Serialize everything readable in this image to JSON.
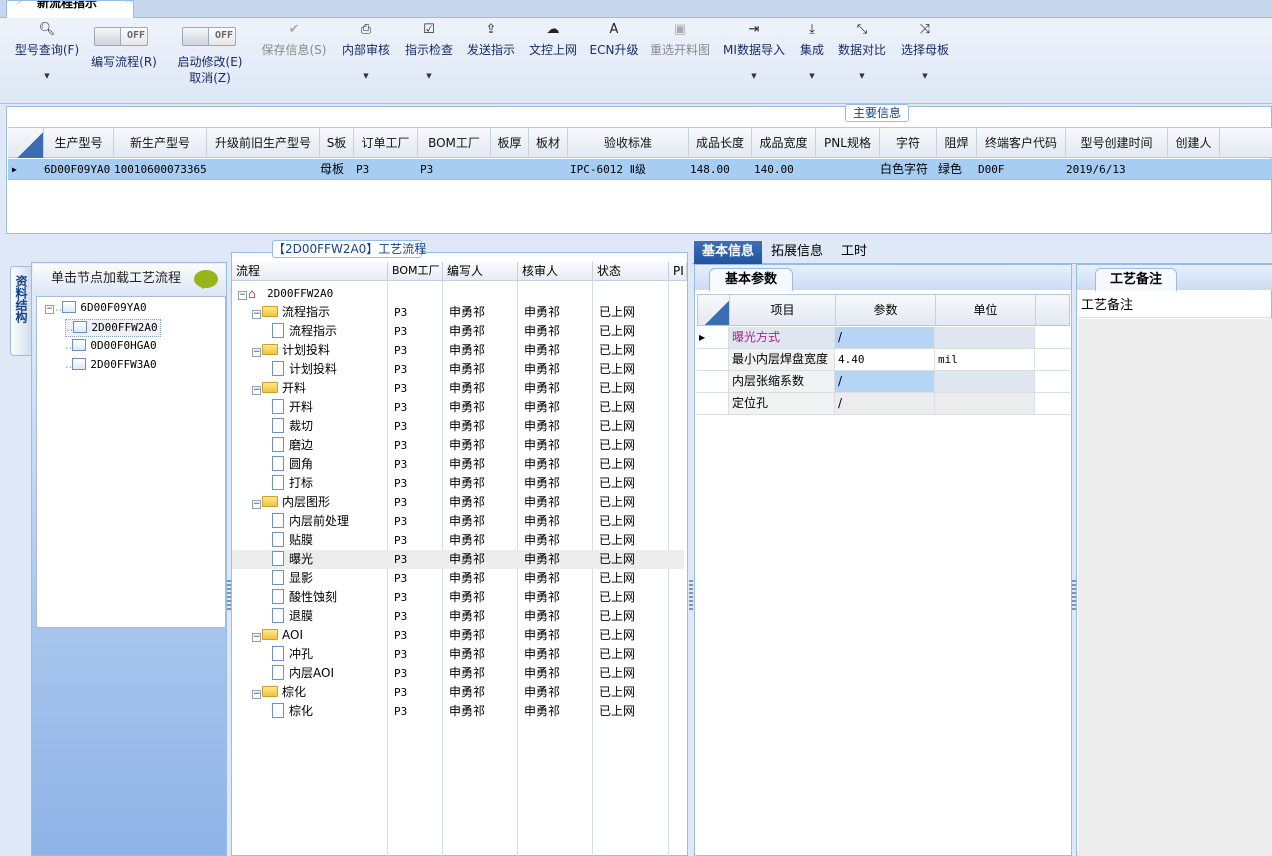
{
  "document_tab": {
    "title": "新流程指示",
    "close": "×"
  },
  "toolbar": {
    "model_query": "型号查询(F)",
    "edit_flow": "编写流程(R)",
    "edit_flow_state": "OFF",
    "start_edit": "启动修改(E)",
    "cancel": "取消(Z)",
    "start_edit_state": "OFF",
    "save_info": "保存信息(S)",
    "internal_review": "内部审核",
    "instruction_check": "指示检查",
    "send_instruction": "发送指示",
    "upload_doc": "文控上网",
    "ecn_upgrade": "ECN升级",
    "reselect_cutting_chart": "重选开料图",
    "mi_import": "MI数据导入",
    "integrate": "集成",
    "data_compare": "数据对比",
    "select_master": "选择母板"
  },
  "main_info": {
    "title": "主要信息",
    "columns": [
      "生产型号",
      "新生产型号",
      "升级前旧生产型号",
      "S板",
      "订单工厂",
      "BOM工厂",
      "板厚",
      "板材",
      "验收标准",
      "成品长度",
      "成品宽度",
      "PNL规格",
      "字符",
      "阻焊",
      "终端客户代码",
      "型号创建时间",
      "创建人"
    ],
    "row": {
      "production_model": "6D00F09YA0",
      "new_model": "10010600073365",
      "old_model": "",
      "s_board": "母板",
      "order_factory": "P3",
      "bom_factory": "P3",
      "thickness": "",
      "material": "",
      "standard": "IPC-6012 Ⅱ级",
      "length": "148.00",
      "width": "140.00",
      "pnl": "",
      "character": "白色字符",
      "solder_mask": "绿色",
      "customer_code": "D00F",
      "created": "2019/6/13",
      "creator": ""
    }
  },
  "side_tab": "资料结构",
  "left_tree": {
    "header": "单击节点加载工艺流程",
    "root": "6D00F09YA0",
    "children": [
      "2D00FFW2A0",
      "0D00F0HGA0",
      "2D00FFW3A0"
    ]
  },
  "process": {
    "title": "【2D00FFW2A0】工艺流程",
    "columns": [
      "流程",
      "BOM工厂",
      "编写人",
      "核审人",
      "状态",
      "PI"
    ],
    "root": "2D00FFW2A0",
    "rows": [
      {
        "name": "流程指示",
        "level": 1,
        "type": "folder",
        "factory": "P3",
        "writer": "申勇祁",
        "reviewer": "申勇祁",
        "status": "已上网"
      },
      {
        "name": "流程指示",
        "level": 2,
        "type": "doc",
        "factory": "P3",
        "writer": "申勇祁",
        "reviewer": "申勇祁",
        "status": "已上网"
      },
      {
        "name": "计划投料",
        "level": 1,
        "type": "folder",
        "factory": "P3",
        "writer": "申勇祁",
        "reviewer": "申勇祁",
        "status": "已上网"
      },
      {
        "name": "计划投料",
        "level": 2,
        "type": "doc",
        "factory": "P3",
        "writer": "申勇祁",
        "reviewer": "申勇祁",
        "status": "已上网"
      },
      {
        "name": "开料",
        "level": 1,
        "type": "folder",
        "factory": "P3",
        "writer": "申勇祁",
        "reviewer": "申勇祁",
        "status": "已上网"
      },
      {
        "name": "开料",
        "level": 2,
        "type": "doc",
        "factory": "P3",
        "writer": "申勇祁",
        "reviewer": "申勇祁",
        "status": "已上网"
      },
      {
        "name": "裁切",
        "level": 2,
        "type": "doc",
        "factory": "P3",
        "writer": "申勇祁",
        "reviewer": "申勇祁",
        "status": "已上网"
      },
      {
        "name": "磨边",
        "level": 2,
        "type": "doc",
        "factory": "P3",
        "writer": "申勇祁",
        "reviewer": "申勇祁",
        "status": "已上网"
      },
      {
        "name": "圆角",
        "level": 2,
        "type": "doc",
        "factory": "P3",
        "writer": "申勇祁",
        "reviewer": "申勇祁",
        "status": "已上网"
      },
      {
        "name": "打标",
        "level": 2,
        "type": "doc",
        "factory": "P3",
        "writer": "申勇祁",
        "reviewer": "申勇祁",
        "status": "已上网"
      },
      {
        "name": "内层图形",
        "level": 1,
        "type": "folder",
        "factory": "P3",
        "writer": "申勇祁",
        "reviewer": "申勇祁",
        "status": "已上网"
      },
      {
        "name": "内层前处理",
        "level": 2,
        "type": "doc",
        "factory": "P3",
        "writer": "申勇祁",
        "reviewer": "申勇祁",
        "status": "已上网"
      },
      {
        "name": "贴膜",
        "level": 2,
        "type": "doc",
        "factory": "P3",
        "writer": "申勇祁",
        "reviewer": "申勇祁",
        "status": "已上网"
      },
      {
        "name": "曝光",
        "level": 2,
        "type": "doc",
        "factory": "P3",
        "writer": "申勇祁",
        "reviewer": "申勇祁",
        "status": "已上网",
        "selected": true
      },
      {
        "name": "显影",
        "level": 2,
        "type": "doc",
        "factory": "P3",
        "writer": "申勇祁",
        "reviewer": "申勇祁",
        "status": "已上网"
      },
      {
        "name": "酸性蚀刻",
        "level": 2,
        "type": "doc",
        "factory": "P3",
        "writer": "申勇祁",
        "reviewer": "申勇祁",
        "status": "已上网"
      },
      {
        "name": "退膜",
        "level": 2,
        "type": "doc",
        "factory": "P3",
        "writer": "申勇祁",
        "reviewer": "申勇祁",
        "status": "已上网"
      },
      {
        "name": "AOI",
        "level": 1,
        "type": "folder",
        "factory": "P3",
        "writer": "申勇祁",
        "reviewer": "申勇祁",
        "status": "已上网"
      },
      {
        "name": "冲孔",
        "level": 2,
        "type": "doc",
        "factory": "P3",
        "writer": "申勇祁",
        "reviewer": "申勇祁",
        "status": "已上网"
      },
      {
        "name": "内层AOI",
        "level": 2,
        "type": "doc",
        "factory": "P3",
        "writer": "申勇祁",
        "reviewer": "申勇祁",
        "status": "已上网"
      },
      {
        "name": "棕化",
        "level": 1,
        "type": "folder",
        "factory": "P3",
        "writer": "申勇祁",
        "reviewer": "申勇祁",
        "status": "已上网"
      },
      {
        "name": "棕化",
        "level": 2,
        "type": "doc",
        "factory": "P3",
        "writer": "申勇祁",
        "reviewer": "申勇祁",
        "status": "已上网"
      }
    ]
  },
  "info_tabs": [
    "基本信息",
    "拓展信息",
    "工时"
  ],
  "basic_params": {
    "tab": "基本参数",
    "columns": [
      "项目",
      "参数",
      "单位"
    ],
    "rows": [
      {
        "item": "曝光方式",
        "value": "/",
        "unit": ""
      },
      {
        "item": "最小内层焊盘宽度",
        "value": "4.40",
        "unit": "mil"
      },
      {
        "item": "内层张缩系数",
        "value": "/",
        "unit": ""
      },
      {
        "item": "定位孔",
        "value": "/",
        "unit": ""
      }
    ]
  },
  "process_notes": {
    "tab": "工艺备注",
    "header": "工艺备注"
  },
  "colors": {
    "accent": "#20549f",
    "selected_row": "#a8cdf3",
    "highlight_text": "#b0228a"
  }
}
